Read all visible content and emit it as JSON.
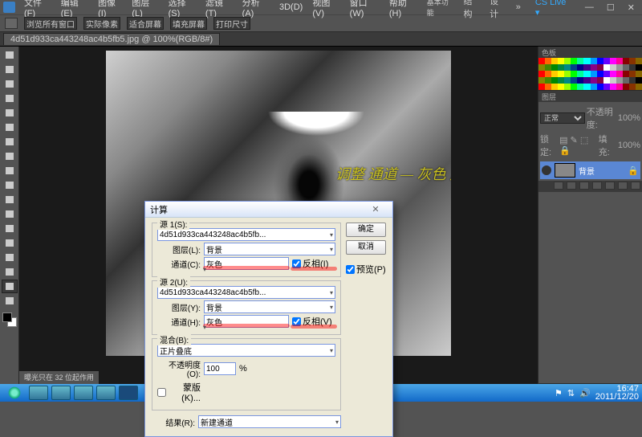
{
  "menu": {
    "items": [
      "文件(F)",
      "编辑(E)",
      "图像(I)",
      "图层(L)",
      "选择(S)",
      "滤镜(T)",
      "分析(A)",
      "3D(D)",
      "视图(V)",
      "窗口(W)",
      "帮助(H)"
    ],
    "dims": [
      "基本功能",
      "结构",
      "设计",
      "»"
    ],
    "cslive": "CS Live ▾"
  },
  "optbar": {
    "arrange": "浏览所有窗口",
    "b1": "实际像素",
    "b2": "适合屏幕",
    "b3": "填充屏幕",
    "b4": "打印尺寸"
  },
  "tab": {
    "name": "4d51d933ca443248ac4b5fb5.jpg @ 100%(RGB/8#)"
  },
  "overlay": "调整 通道 — 灰色 反向挑勾",
  "status": "曝光只在 32 位起作用",
  "panels": {
    "swatches": "色板",
    "layers": "图层",
    "layer_mode": "正常",
    "opacity_lbl": "不透明度:",
    "opacity": "100%",
    "lock_lbl": "锁定:",
    "fill_lbl": "填充:",
    "fill": "100%",
    "layer_name": "背景"
  },
  "dialog": {
    "title": "计算",
    "src1": "源 1(S):",
    "src1_val": "4d51d933ca443248ac4b5fb...",
    "layerL": "图层(L):",
    "layer_val": "背景",
    "chanC": "通道(C):",
    "chan_val": "灰色",
    "invI": "反相(I)",
    "src2": "源 2(U):",
    "src2_val": "4d51d933ca443248ac4b5fb...",
    "layerY": "图层(Y):",
    "chanH": "通道(H):",
    "invV": "反相(V)",
    "blendB": "混合(B):",
    "blend_val": "正片叠底",
    "opacO": "不透明度(O):",
    "opac_val": "100",
    "pct": "%",
    "maskK": "蒙版(K)...",
    "resR": "结果(R):",
    "res_val": "新建通道",
    "ok": "确定",
    "cancel": "取消",
    "preview": "预览(P)"
  },
  "taskbar": {
    "time": "16:47",
    "date": "2011/12/20"
  }
}
